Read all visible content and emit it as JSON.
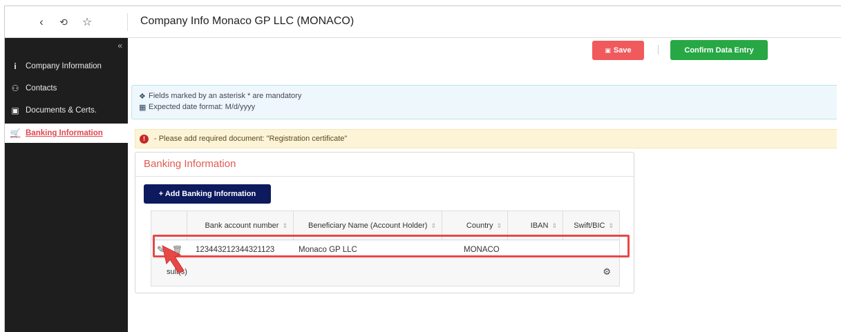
{
  "topbar": {
    "back_icon": "chevron-left-icon",
    "history_icon": "history-icon",
    "favorite_icon": "star-icon",
    "title": "Company Info Monaco GP LLC (MONACO)"
  },
  "sidebar": {
    "collapse_icon": "double-chevron-left-icon",
    "items": [
      {
        "label": "Company Information",
        "icon": "info-icon",
        "active": false
      },
      {
        "label": "Contacts",
        "icon": "users-icon",
        "active": false
      },
      {
        "label": "Documents & Certs.",
        "icon": "document-icon",
        "active": false
      },
      {
        "label": "Banking Information",
        "icon": "cart-icon",
        "active": true
      }
    ]
  },
  "actions": {
    "save_label": "Save",
    "confirm_label": "Confirm Data Entry"
  },
  "info": {
    "mandatory_text": "Fields marked by an asterisk * are mandatory",
    "date_format_text": "Expected date format: M/d/yyyy"
  },
  "warning": {
    "text": "- Please add required document: \"Registration certificate\""
  },
  "panel": {
    "title": "Banking Information",
    "add_button_label": "+ Add Banking Information"
  },
  "table": {
    "columns": [
      "Bank account number",
      "Beneficiary Name (Account Holder)",
      "Country",
      "IBAN",
      "Swift/BIC"
    ],
    "rows": [
      {
        "account": "123443212344321123",
        "beneficiary": "Monaco GP LLC",
        "country": "MONACO",
        "iban": "",
        "swift": ""
      }
    ],
    "results_text": "1 Result(s)",
    "results_visible_text": "sult(s)"
  },
  "colors": {
    "accent_red": "#f05a5d",
    "confirm_green": "#27a844",
    "add_navy": "#0d1a5e",
    "highlight": "#e84747"
  }
}
